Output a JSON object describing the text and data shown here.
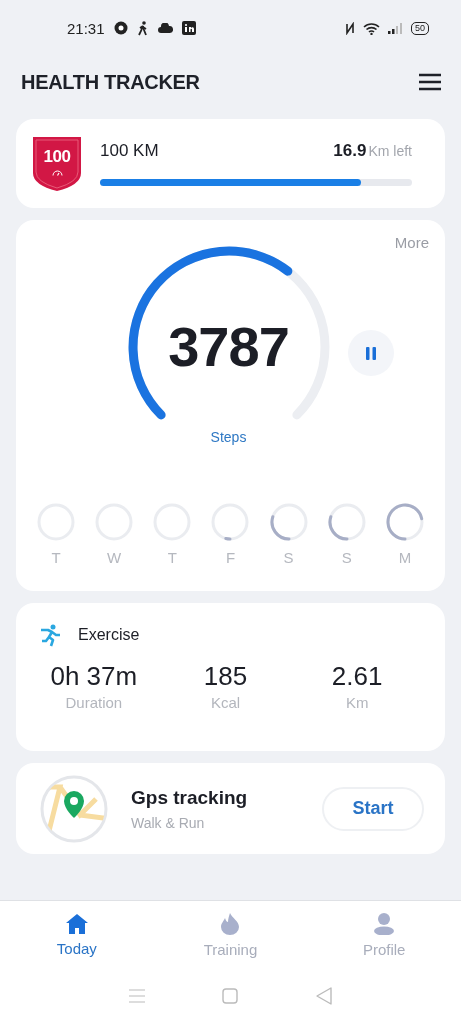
{
  "status_bar": {
    "time": "21:31",
    "battery": "50"
  },
  "header": {
    "title": "HEALTH TRACKER"
  },
  "goal": {
    "badge": "100",
    "title": "100 KM",
    "remaining": "16.9",
    "remaining_unit": "Km left",
    "level": 0.835
  },
  "steps": {
    "more": "More",
    "count": "3787",
    "label": "Steps",
    "days": [
      {
        "label": "T"
      },
      {
        "label": "W"
      },
      {
        "label": "T"
      },
      {
        "label": "F"
      },
      {
        "label": "S"
      },
      {
        "label": "S"
      },
      {
        "label": "M"
      }
    ]
  },
  "exercise": {
    "title": "Exercise",
    "stats": [
      {
        "value": "0h 37m",
        "label": "Duration"
      },
      {
        "value": "185",
        "label": "Kcal"
      },
      {
        "value": "2.61",
        "label": "Km"
      }
    ]
  },
  "gps": {
    "title": "Gps tracking",
    "subtitle": "Walk & Run",
    "button": "Start"
  },
  "bottom_nav": [
    {
      "label": "Today",
      "kind": "home",
      "selected": true
    },
    {
      "label": "Training",
      "kind": "flame",
      "selected": false
    },
    {
      "label": "Profile",
      "kind": "person",
      "selected": false
    }
  ]
}
